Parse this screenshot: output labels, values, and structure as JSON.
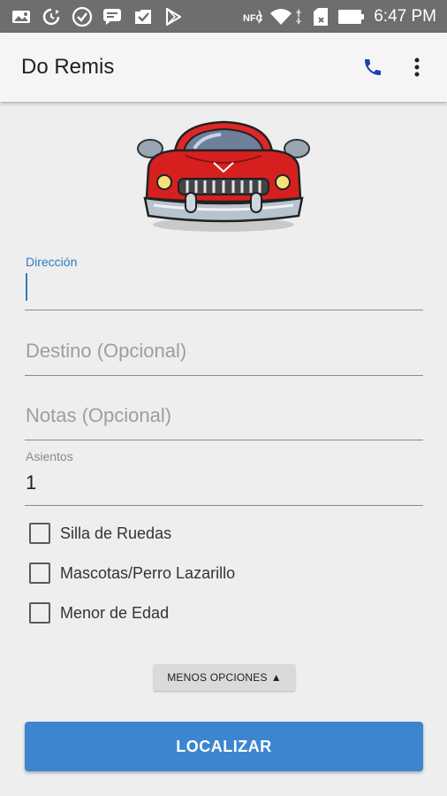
{
  "status_bar": {
    "time": "6:47 PM",
    "icons": [
      "gallery-icon",
      "sync-icon",
      "check-circle-icon",
      "chat-icon",
      "download-icon",
      "play-store-icon",
      "nfc-icon",
      "wifi-icon",
      "data-arrows-icon",
      "sim-icon",
      "battery-icon"
    ],
    "nfc_text": "NFC"
  },
  "app_bar": {
    "title": "Do Remis",
    "actions": [
      "phone-icon",
      "more-vert-icon"
    ],
    "accent": "#1a3fb5"
  },
  "form": {
    "direccion": {
      "label": "Dirección",
      "value": ""
    },
    "destino": {
      "placeholder": "Destino (Opcional)"
    },
    "notas": {
      "placeholder": "Notas (Opcional)"
    },
    "asientos": {
      "label": "Asientos",
      "value": "1"
    }
  },
  "options": [
    {
      "label": "Silla de Ruedas",
      "checked": false
    },
    {
      "label": "Mascotas/Perro Lazarillo",
      "checked": false
    },
    {
      "label": "Menor de Edad",
      "checked": false
    }
  ],
  "buttons": {
    "menos_opciones": "MENOS OPCIONES",
    "menos_opciones_arrow": "▲",
    "localizar": "LOCALIZAR"
  },
  "colors": {
    "primary": "#3d86cf",
    "focus_label": "#2e7bc4",
    "car_red": "#d62020"
  }
}
